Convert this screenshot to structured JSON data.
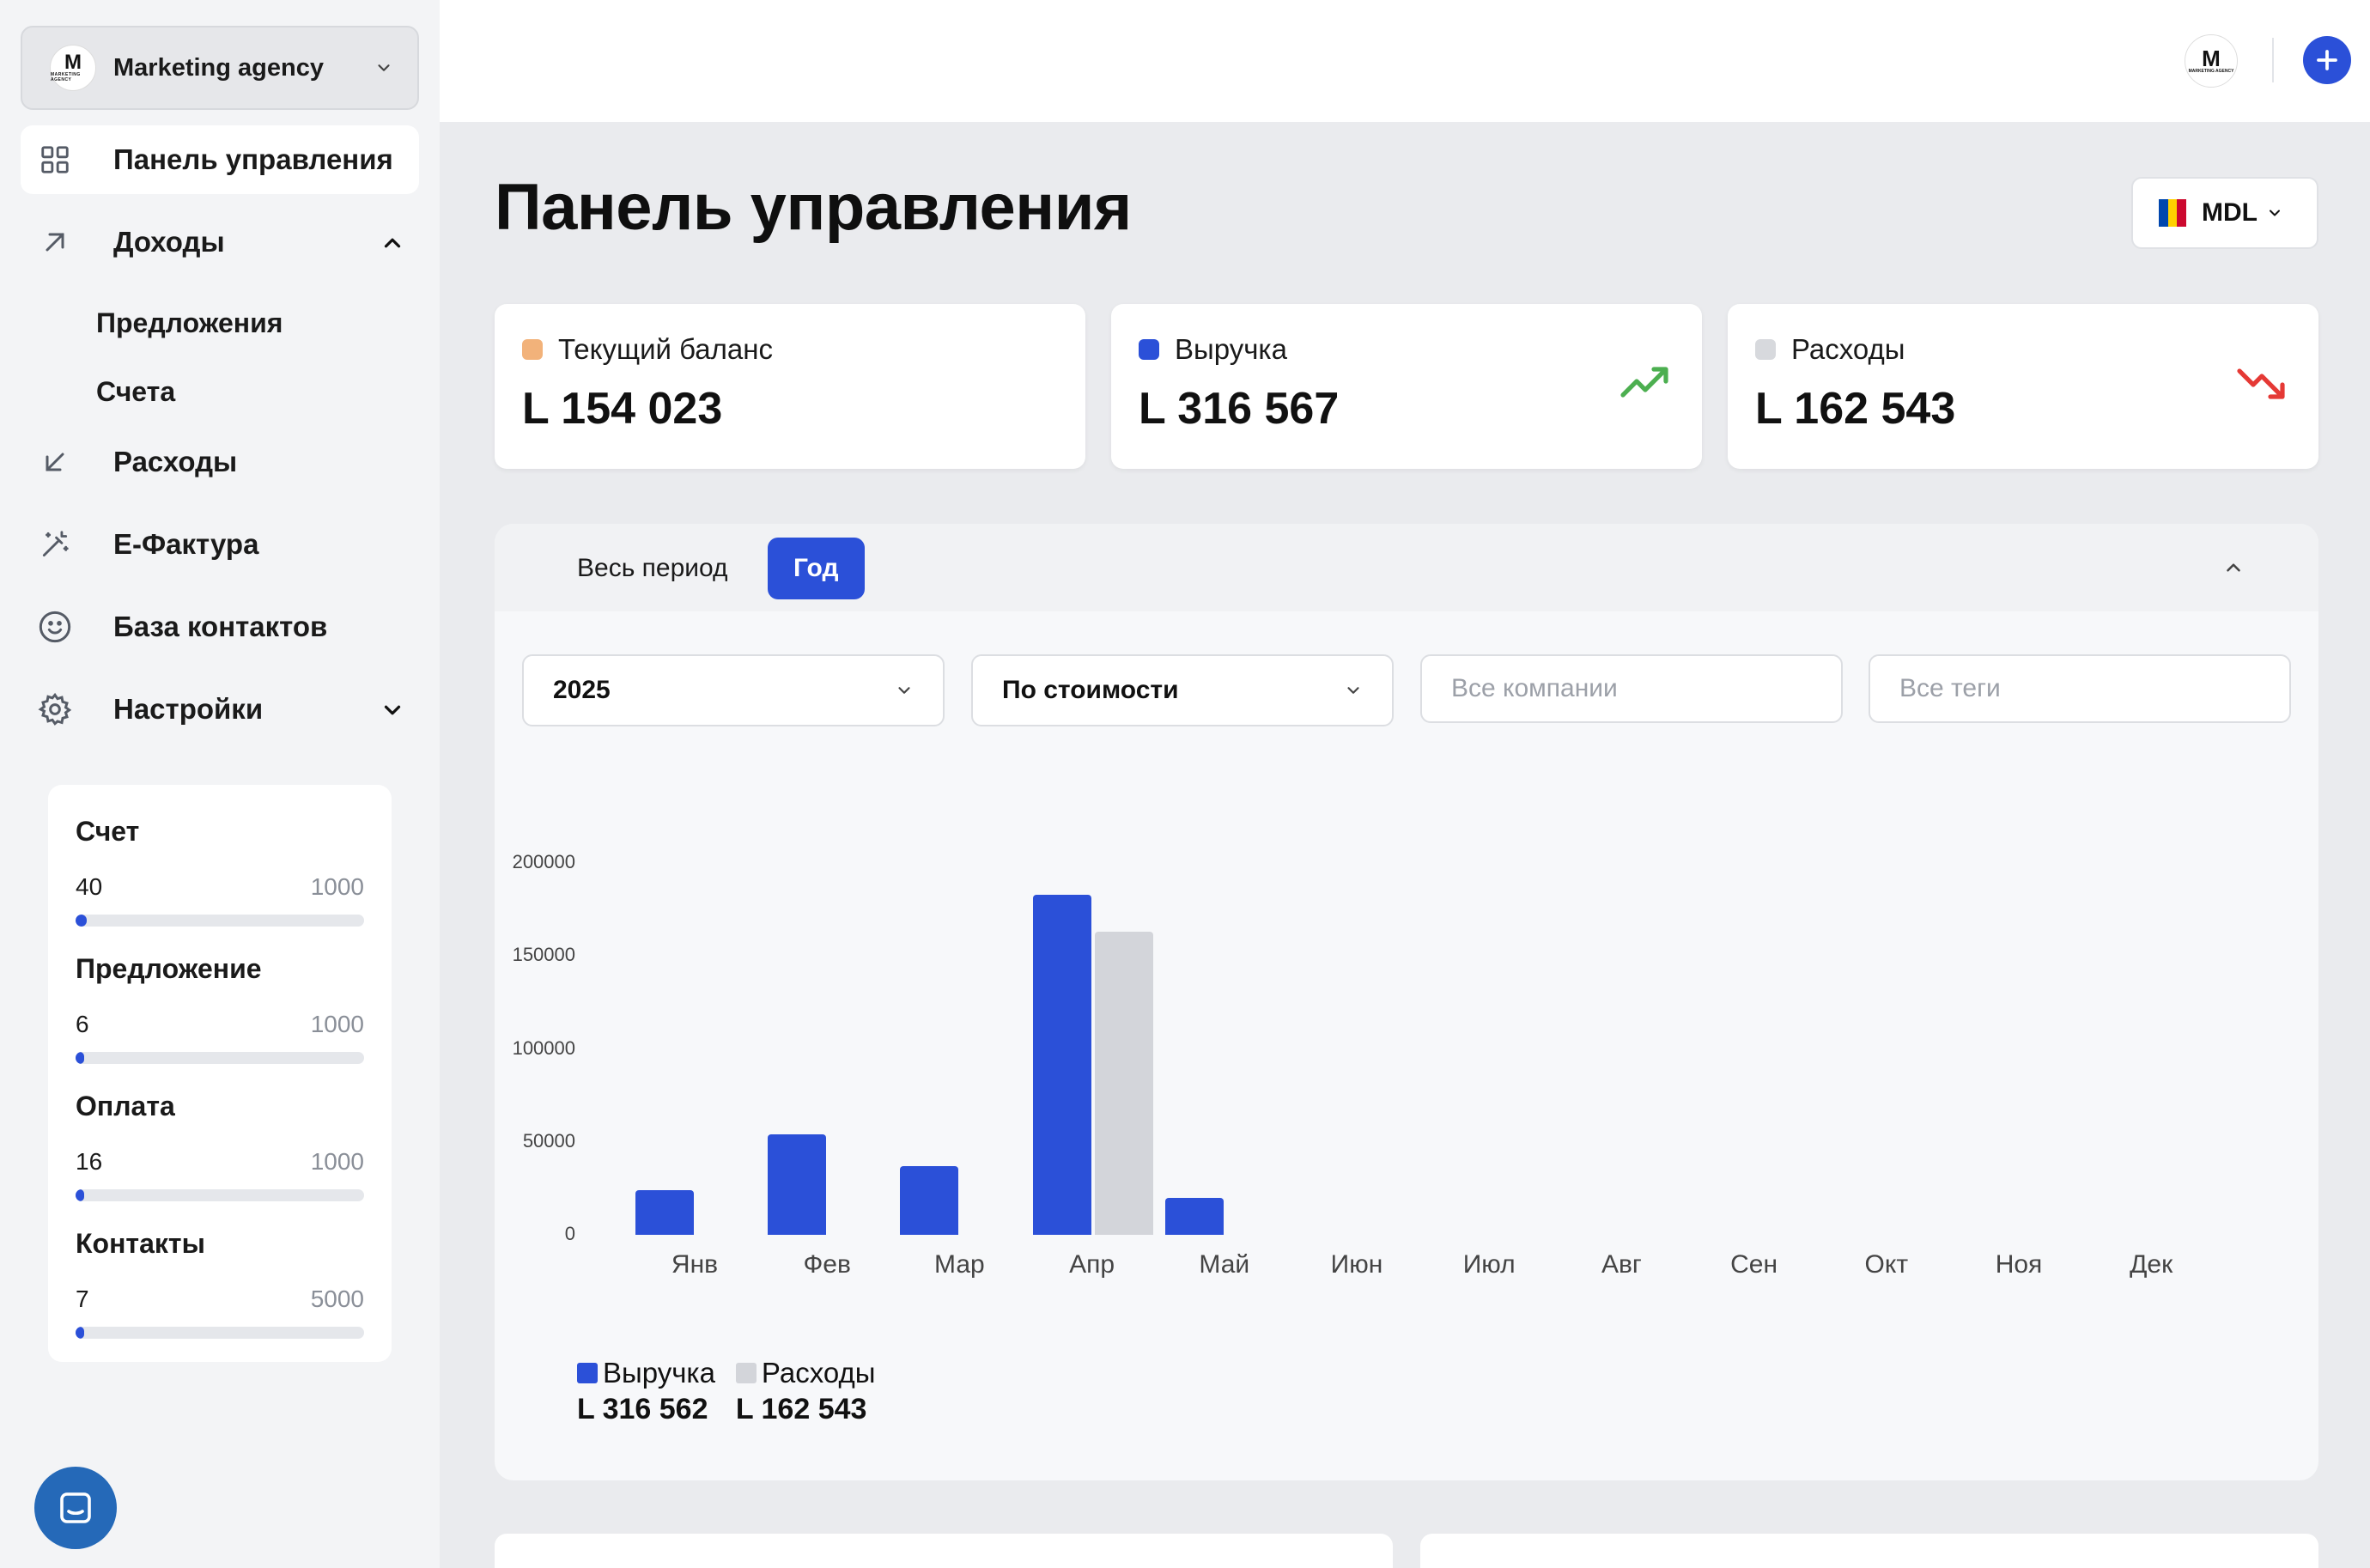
{
  "org": {
    "logo_letter": "M",
    "logo_sub": "MARKETING AGENCY",
    "name": "Marketing agency"
  },
  "nav": {
    "dashboard": "Панель управления",
    "income": "Доходы",
    "income_sub": [
      "Предложения",
      "Счета"
    ],
    "expenses": "Расходы",
    "efactura": "E-Фактура",
    "contacts": "База контактов",
    "settings": "Настройки"
  },
  "limits": [
    {
      "title": "Счет",
      "used": "40",
      "max": "1000",
      "fraction": 0.04
    },
    {
      "title": "Предложение",
      "used": "6",
      "max": "1000",
      "fraction": 0.006
    },
    {
      "title": "Оплата",
      "used": "16",
      "max": "1000",
      "fraction": 0.016
    },
    {
      "title": "Контакты",
      "used": "7",
      "max": "5000",
      "fraction": 0.0014
    }
  ],
  "page": {
    "title": "Панель управления",
    "currency": "MDL"
  },
  "stats": {
    "balance": {
      "label": "Текущий баланс",
      "value": "L 154 023",
      "color": "#f2b27a"
    },
    "revenue": {
      "label": "Выручка",
      "value": "L 316 567",
      "color": "#2b50d8"
    },
    "expenses": {
      "label": "Расходы",
      "value": "L 162 543",
      "color": "#d7d9dd"
    }
  },
  "tabs": {
    "all": "Весь период",
    "year": "Год"
  },
  "filters": {
    "year": "2025",
    "sort": "По стоимости",
    "companies_placeholder": "Все компании",
    "tags_placeholder": "Все теги"
  },
  "colors": {
    "accent": "#2b50d8",
    "expense": "#d3d5da",
    "up": "#4caf50",
    "down": "#e53935"
  },
  "chart_data": {
    "type": "bar",
    "categories": [
      "Янв",
      "Фев",
      "Мар",
      "Апр",
      "Май",
      "Июн",
      "Июл",
      "Авг",
      "Сен",
      "Окт",
      "Ноя",
      "Дек"
    ],
    "series": [
      {
        "name": "Выручка",
        "values": [
          24000,
          54000,
          37000,
          183000,
          20000,
          0,
          0,
          0,
          0,
          0,
          0,
          0
        ]
      },
      {
        "name": "Расходы",
        "values": [
          0,
          0,
          0,
          163000,
          0,
          0,
          0,
          0,
          0,
          0,
          0,
          0
        ]
      }
    ],
    "yticks": [
      "0",
      "50000",
      "100000",
      "150000",
      "200000"
    ],
    "ylim": [
      0,
      200000
    ],
    "grid": false,
    "legend": {
      "position": "bottom-left",
      "items": [
        {
          "name": "Выручка",
          "total": "L 316 562"
        },
        {
          "name": "Расходы",
          "total": "L 162 543"
        }
      ]
    }
  }
}
